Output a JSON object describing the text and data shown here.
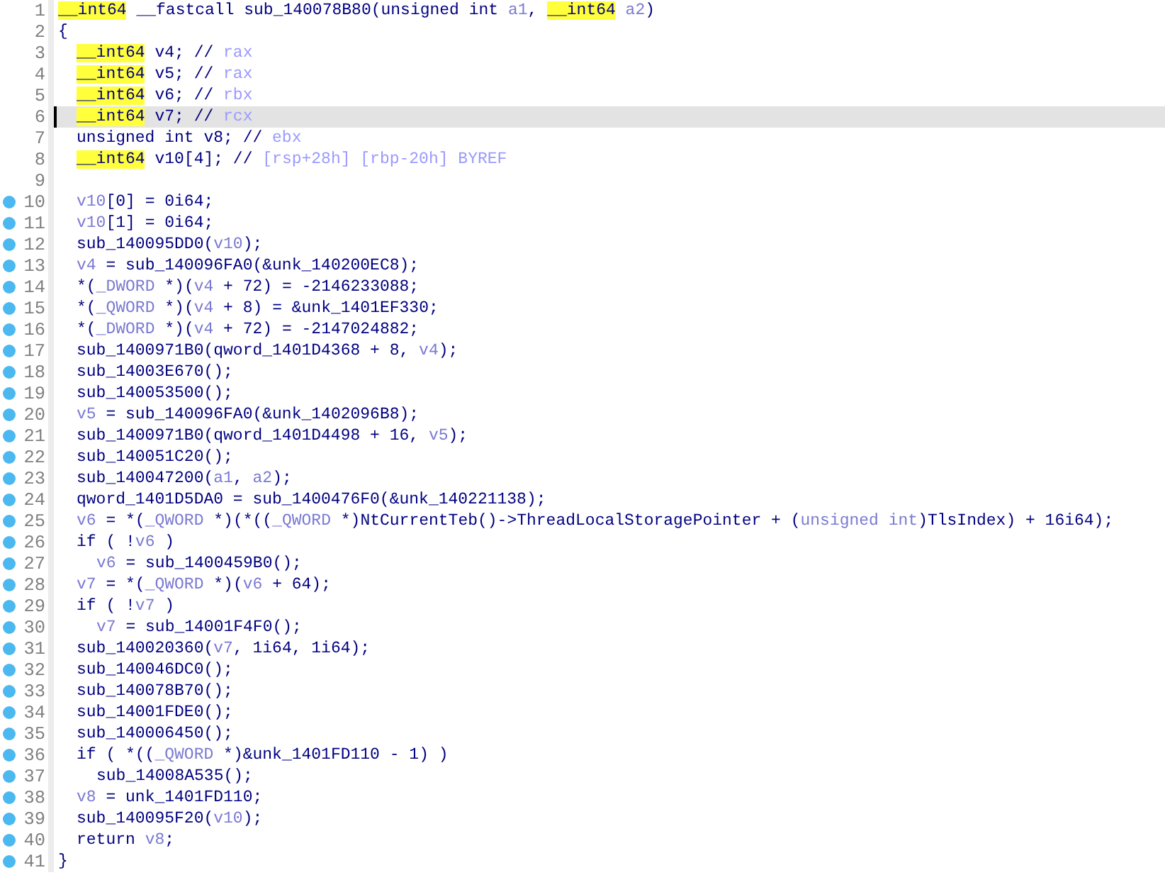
{
  "lines": [
    {
      "number": "1",
      "breakpoint": false,
      "selected": false,
      "kind": "top",
      "tokens": [
        {
          "kind": "type",
          "text": "__int64"
        },
        {
          "kind": "plain",
          "text": " __fastcall sub_140078B80(unsigned int "
        },
        {
          "kind": "var",
          "text": "a1"
        },
        {
          "kind": "plain",
          "text": ", "
        },
        {
          "kind": "type",
          "text": "__int64"
        },
        {
          "kind": "var",
          "text": " a2"
        },
        {
          "kind": "plain",
          "text": ")"
        }
      ]
    },
    {
      "number": "2",
      "breakpoint": false,
      "selected": false,
      "kind": "top",
      "tokens": [
        {
          "kind": "plain",
          "text": "{"
        }
      ]
    },
    {
      "number": "3",
      "breakpoint": false,
      "selected": false,
      "kind": "body",
      "tokens": [
        {
          "kind": "type",
          "text": "__int64"
        },
        {
          "kind": "plain",
          "text": " v4; // "
        },
        {
          "kind": "comment",
          "text": "rax"
        }
      ]
    },
    {
      "number": "4",
      "breakpoint": false,
      "selected": false,
      "kind": "body",
      "tokens": [
        {
          "kind": "type",
          "text": "__int64"
        },
        {
          "kind": "plain",
          "text": " v5; // "
        },
        {
          "kind": "comment",
          "text": "rax"
        }
      ]
    },
    {
      "number": "5",
      "breakpoint": false,
      "selected": false,
      "kind": "body",
      "tokens": [
        {
          "kind": "type",
          "text": "__int64"
        },
        {
          "kind": "plain",
          "text": " v6; // "
        },
        {
          "kind": "comment",
          "text": "rbx"
        }
      ]
    },
    {
      "number": "6",
      "breakpoint": false,
      "selected": true,
      "kind": "body",
      "tokens": [
        {
          "kind": "type",
          "text": "__int64"
        },
        {
          "kind": "plain",
          "text": " v7; // "
        },
        {
          "kind": "comment",
          "text": "rcx"
        }
      ]
    },
    {
      "number": "7",
      "breakpoint": false,
      "selected": false,
      "kind": "body",
      "tokens": [
        {
          "kind": "plain",
          "text": "unsigned int v8; // "
        },
        {
          "kind": "comment",
          "text": "ebx"
        }
      ]
    },
    {
      "number": "8",
      "breakpoint": false,
      "selected": false,
      "kind": "body",
      "tokens": [
        {
          "kind": "type",
          "text": "__int64"
        },
        {
          "kind": "plain",
          "text": " v10[4]; // "
        },
        {
          "kind": "comment",
          "text": "[rsp+28h] [rbp-20h] BYREF"
        }
      ]
    },
    {
      "number": "9",
      "breakpoint": false,
      "selected": false,
      "kind": "top"
    },
    {
      "number": "10",
      "breakpoint": true,
      "selected": false,
      "kind": "body",
      "tokens": [
        {
          "kind": "var",
          "text": "v10"
        },
        {
          "kind": "plain",
          "text": "[0] = 0i64;"
        }
      ]
    },
    {
      "number": "11",
      "breakpoint": true,
      "selected": false,
      "kind": "body",
      "tokens": [
        {
          "kind": "var",
          "text": "v10"
        },
        {
          "kind": "plain",
          "text": "[1] = 0i64;"
        }
      ]
    },
    {
      "number": "12",
      "breakpoint": true,
      "selected": false,
      "kind": "body",
      "tokens": [
        {
          "kind": "plain",
          "text": "sub_140095DD0("
        },
        {
          "kind": "var",
          "text": "v10"
        },
        {
          "kind": "plain",
          "text": ");"
        }
      ]
    },
    {
      "number": "13",
      "breakpoint": true,
      "selected": false,
      "kind": "body",
      "tokens": [
        {
          "kind": "var",
          "text": "v4"
        },
        {
          "kind": "plain",
          "text": " = sub_140096FA0(&unk_140200EC8);"
        }
      ]
    },
    {
      "number": "14",
      "breakpoint": true,
      "selected": false,
      "kind": "body",
      "tokens": [
        {
          "kind": "plain",
          "text": "*("
        },
        {
          "kind": "var",
          "text": "_DWORD"
        },
        {
          "kind": "plain",
          "text": " *)("
        },
        {
          "kind": "var",
          "text": "v4"
        },
        {
          "kind": "plain",
          "text": " + 72) = -2146233088;"
        }
      ]
    },
    {
      "number": "15",
      "breakpoint": true,
      "selected": false,
      "kind": "body",
      "tokens": [
        {
          "kind": "plain",
          "text": "*("
        },
        {
          "kind": "var",
          "text": "_QWORD"
        },
        {
          "kind": "plain",
          "text": " *)("
        },
        {
          "kind": "var",
          "text": "v4"
        },
        {
          "kind": "plain",
          "text": " + 8) = &unk_1401EF330;"
        }
      ]
    },
    {
      "number": "16",
      "breakpoint": true,
      "selected": false,
      "kind": "body",
      "tokens": [
        {
          "kind": "plain",
          "text": "*("
        },
        {
          "kind": "var",
          "text": "_DWORD"
        },
        {
          "kind": "plain",
          "text": " *)("
        },
        {
          "kind": "var",
          "text": "v4"
        },
        {
          "kind": "plain",
          "text": " + 72) = -2147024882;"
        }
      ]
    },
    {
      "number": "17",
      "breakpoint": true,
      "selected": false,
      "kind": "body",
      "tokens": [
        {
          "kind": "plain",
          "text": "sub_1400971B0(qword_1401D4368 + 8, "
        },
        {
          "kind": "var",
          "text": "v4"
        },
        {
          "kind": "plain",
          "text": ");"
        }
      ]
    },
    {
      "number": "18",
      "breakpoint": true,
      "selected": false,
      "kind": "body",
      "tokens": [
        {
          "kind": "plain",
          "text": "sub_14003E670();"
        }
      ]
    },
    {
      "number": "19",
      "breakpoint": true,
      "selected": false,
      "kind": "body",
      "tokens": [
        {
          "kind": "plain",
          "text": "sub_140053500();"
        }
      ]
    },
    {
      "number": "20",
      "breakpoint": true,
      "selected": false,
      "kind": "body",
      "tokens": [
        {
          "kind": "var",
          "text": "v5"
        },
        {
          "kind": "plain",
          "text": " = sub_140096FA0(&unk_1402096B8);"
        }
      ]
    },
    {
      "number": "21",
      "breakpoint": true,
      "selected": false,
      "kind": "body",
      "tokens": [
        {
          "kind": "plain",
          "text": "sub_1400971B0(qword_1401D4498 + 16, "
        },
        {
          "kind": "var",
          "text": "v5"
        },
        {
          "kind": "plain",
          "text": ");"
        }
      ]
    },
    {
      "number": "22",
      "breakpoint": true,
      "selected": false,
      "kind": "body",
      "tokens": [
        {
          "kind": "plain",
          "text": "sub_140051C20();"
        }
      ]
    },
    {
      "number": "23",
      "breakpoint": true,
      "selected": false,
      "kind": "body",
      "tokens": [
        {
          "kind": "plain",
          "text": "sub_140047200("
        },
        {
          "kind": "var",
          "text": "a1"
        },
        {
          "kind": "plain",
          "text": ", "
        },
        {
          "kind": "var",
          "text": "a2"
        },
        {
          "kind": "plain",
          "text": ");"
        }
      ]
    },
    {
      "number": "24",
      "breakpoint": true,
      "selected": false,
      "kind": "body",
      "tokens": [
        {
          "kind": "plain",
          "text": "qword_1401D5DA0 = sub_1400476F0(&unk_140221138);"
        }
      ]
    },
    {
      "number": "25",
      "breakpoint": true,
      "selected": false,
      "kind": "body",
      "tokens": [
        {
          "kind": "var",
          "text": "v6"
        },
        {
          "kind": "plain",
          "text": " = *("
        },
        {
          "kind": "var",
          "text": "_QWORD"
        },
        {
          "kind": "plain",
          "text": " *)(*(("
        },
        {
          "kind": "var",
          "text": "_QWORD"
        },
        {
          "kind": "plain",
          "text": " *)NtCurrentTeb()->ThreadLocalStoragePointer + ("
        },
        {
          "kind": "var",
          "text": "unsigned int"
        },
        {
          "kind": "plain",
          "text": ")TlsIndex) + 16i64);"
        }
      ]
    },
    {
      "number": "26",
      "breakpoint": true,
      "selected": false,
      "kind": "body",
      "tokens": [
        {
          "kind": "plain",
          "text": "if ( !"
        },
        {
          "kind": "var",
          "text": "v6"
        },
        {
          "kind": "plain",
          "text": " )"
        }
      ]
    },
    {
      "number": "27",
      "breakpoint": true,
      "selected": false,
      "kind": "inner",
      "tokens": [
        {
          "kind": "var",
          "text": "v6"
        },
        {
          "kind": "plain",
          "text": " = sub_1400459B0();"
        }
      ]
    },
    {
      "number": "28",
      "breakpoint": true,
      "selected": false,
      "kind": "body",
      "tokens": [
        {
          "kind": "var",
          "text": "v7"
        },
        {
          "kind": "plain",
          "text": " = *("
        },
        {
          "kind": "var",
          "text": "_QWORD"
        },
        {
          "kind": "plain",
          "text": " *)("
        },
        {
          "kind": "var",
          "text": "v6"
        },
        {
          "kind": "plain",
          "text": " + 64);"
        }
      ]
    },
    {
      "number": "29",
      "breakpoint": true,
      "selected": false,
      "kind": "body",
      "tokens": [
        {
          "kind": "plain",
          "text": "if ( !"
        },
        {
          "kind": "var",
          "text": "v7"
        },
        {
          "kind": "plain",
          "text": " )"
        }
      ]
    },
    {
      "number": "30",
      "breakpoint": true,
      "selected": false,
      "kind": "inner",
      "tokens": [
        {
          "kind": "var",
          "text": "v7"
        },
        {
          "kind": "plain",
          "text": " = sub_14001F4F0();"
        }
      ]
    },
    {
      "number": "31",
      "breakpoint": true,
      "selected": false,
      "kind": "body",
      "tokens": [
        {
          "kind": "plain",
          "text": "sub_140020360("
        },
        {
          "kind": "var",
          "text": "v7"
        },
        {
          "kind": "plain",
          "text": ", 1i64, 1i64);"
        }
      ]
    },
    {
      "number": "32",
      "breakpoint": true,
      "selected": false,
      "kind": "body",
      "tokens": [
        {
          "kind": "plain",
          "text": "sub_140046DC0();"
        }
      ]
    },
    {
      "number": "33",
      "breakpoint": true,
      "selected": false,
      "kind": "body",
      "tokens": [
        {
          "kind": "plain",
          "text": "sub_140078B70();"
        }
      ]
    },
    {
      "number": "34",
      "breakpoint": true,
      "selected": false,
      "kind": "body",
      "tokens": [
        {
          "kind": "plain",
          "text": "sub_14001FDE0();"
        }
      ]
    },
    {
      "number": "35",
      "breakpoint": true,
      "selected": false,
      "kind": "body",
      "tokens": [
        {
          "kind": "plain",
          "text": "sub_140006450();"
        }
      ]
    },
    {
      "number": "36",
      "breakpoint": true,
      "selected": false,
      "kind": "body",
      "tokens": [
        {
          "kind": "plain",
          "text": "if ( *(("
        },
        {
          "kind": "var",
          "text": "_QWORD"
        },
        {
          "kind": "plain",
          "text": " *)&unk_1401FD110 - 1) )"
        }
      ]
    },
    {
      "number": "37",
      "breakpoint": true,
      "selected": false,
      "kind": "inner",
      "tokens": [
        {
          "kind": "plain",
          "text": "sub_14008A535();"
        }
      ]
    },
    {
      "number": "38",
      "breakpoint": true,
      "selected": false,
      "kind": "body",
      "tokens": [
        {
          "kind": "var",
          "text": "v8"
        },
        {
          "kind": "plain",
          "text": " = unk_1401FD110;"
        }
      ]
    },
    {
      "number": "39",
      "breakpoint": true,
      "selected": false,
      "kind": "body",
      "tokens": [
        {
          "kind": "plain",
          "text": "sub_140095F20("
        },
        {
          "kind": "var",
          "text": "v10"
        },
        {
          "kind": "plain",
          "text": ");"
        }
      ]
    },
    {
      "number": "40",
      "breakpoint": true,
      "selected": false,
      "kind": "body",
      "tokens": [
        {
          "kind": "plain",
          "text": "return "
        },
        {
          "kind": "var",
          "text": "v8"
        },
        {
          "kind": "plain",
          "text": ";"
        }
      ]
    },
    {
      "number": "41",
      "breakpoint": true,
      "selected": false,
      "kind": "top",
      "tokens": [
        {
          "kind": "plain",
          "text": "}"
        }
      ]
    }
  ]
}
